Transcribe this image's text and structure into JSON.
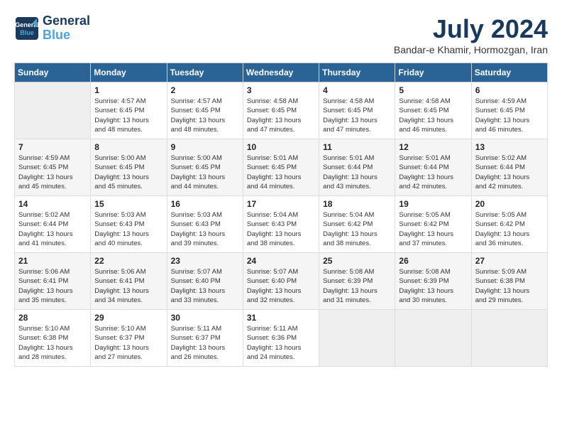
{
  "header": {
    "logo_line1": "General",
    "logo_line2": "Blue",
    "month": "July 2024",
    "location": "Bandar-e Khamir, Hormozgan, Iran"
  },
  "weekdays": [
    "Sunday",
    "Monday",
    "Tuesday",
    "Wednesday",
    "Thursday",
    "Friday",
    "Saturday"
  ],
  "weeks": [
    [
      {
        "day": "",
        "info": ""
      },
      {
        "day": "1",
        "info": "Sunrise: 4:57 AM\nSunset: 6:45 PM\nDaylight: 13 hours\nand 48 minutes."
      },
      {
        "day": "2",
        "info": "Sunrise: 4:57 AM\nSunset: 6:45 PM\nDaylight: 13 hours\nand 48 minutes."
      },
      {
        "day": "3",
        "info": "Sunrise: 4:58 AM\nSunset: 6:45 PM\nDaylight: 13 hours\nand 47 minutes."
      },
      {
        "day": "4",
        "info": "Sunrise: 4:58 AM\nSunset: 6:45 PM\nDaylight: 13 hours\nand 47 minutes."
      },
      {
        "day": "5",
        "info": "Sunrise: 4:58 AM\nSunset: 6:45 PM\nDaylight: 13 hours\nand 46 minutes."
      },
      {
        "day": "6",
        "info": "Sunrise: 4:59 AM\nSunset: 6:45 PM\nDaylight: 13 hours\nand 46 minutes."
      }
    ],
    [
      {
        "day": "7",
        "info": "Sunrise: 4:59 AM\nSunset: 6:45 PM\nDaylight: 13 hours\nand 45 minutes."
      },
      {
        "day": "8",
        "info": "Sunrise: 5:00 AM\nSunset: 6:45 PM\nDaylight: 13 hours\nand 45 minutes."
      },
      {
        "day": "9",
        "info": "Sunrise: 5:00 AM\nSunset: 6:45 PM\nDaylight: 13 hours\nand 44 minutes."
      },
      {
        "day": "10",
        "info": "Sunrise: 5:01 AM\nSunset: 6:45 PM\nDaylight: 13 hours\nand 44 minutes."
      },
      {
        "day": "11",
        "info": "Sunrise: 5:01 AM\nSunset: 6:44 PM\nDaylight: 13 hours\nand 43 minutes."
      },
      {
        "day": "12",
        "info": "Sunrise: 5:01 AM\nSunset: 6:44 PM\nDaylight: 13 hours\nand 42 minutes."
      },
      {
        "day": "13",
        "info": "Sunrise: 5:02 AM\nSunset: 6:44 PM\nDaylight: 13 hours\nand 42 minutes."
      }
    ],
    [
      {
        "day": "14",
        "info": "Sunrise: 5:02 AM\nSunset: 6:44 PM\nDaylight: 13 hours\nand 41 minutes."
      },
      {
        "day": "15",
        "info": "Sunrise: 5:03 AM\nSunset: 6:43 PM\nDaylight: 13 hours\nand 40 minutes."
      },
      {
        "day": "16",
        "info": "Sunrise: 5:03 AM\nSunset: 6:43 PM\nDaylight: 13 hours\nand 39 minutes."
      },
      {
        "day": "17",
        "info": "Sunrise: 5:04 AM\nSunset: 6:43 PM\nDaylight: 13 hours\nand 38 minutes."
      },
      {
        "day": "18",
        "info": "Sunrise: 5:04 AM\nSunset: 6:42 PM\nDaylight: 13 hours\nand 38 minutes."
      },
      {
        "day": "19",
        "info": "Sunrise: 5:05 AM\nSunset: 6:42 PM\nDaylight: 13 hours\nand 37 minutes."
      },
      {
        "day": "20",
        "info": "Sunrise: 5:05 AM\nSunset: 6:42 PM\nDaylight: 13 hours\nand 36 minutes."
      }
    ],
    [
      {
        "day": "21",
        "info": "Sunrise: 5:06 AM\nSunset: 6:41 PM\nDaylight: 13 hours\nand 35 minutes."
      },
      {
        "day": "22",
        "info": "Sunrise: 5:06 AM\nSunset: 6:41 PM\nDaylight: 13 hours\nand 34 minutes."
      },
      {
        "day": "23",
        "info": "Sunrise: 5:07 AM\nSunset: 6:40 PM\nDaylight: 13 hours\nand 33 minutes."
      },
      {
        "day": "24",
        "info": "Sunrise: 5:07 AM\nSunset: 6:40 PM\nDaylight: 13 hours\nand 32 minutes."
      },
      {
        "day": "25",
        "info": "Sunrise: 5:08 AM\nSunset: 6:39 PM\nDaylight: 13 hours\nand 31 minutes."
      },
      {
        "day": "26",
        "info": "Sunrise: 5:08 AM\nSunset: 6:39 PM\nDaylight: 13 hours\nand 30 minutes."
      },
      {
        "day": "27",
        "info": "Sunrise: 5:09 AM\nSunset: 6:38 PM\nDaylight: 13 hours\nand 29 minutes."
      }
    ],
    [
      {
        "day": "28",
        "info": "Sunrise: 5:10 AM\nSunset: 6:38 PM\nDaylight: 13 hours\nand 28 minutes."
      },
      {
        "day": "29",
        "info": "Sunrise: 5:10 AM\nSunset: 6:37 PM\nDaylight: 13 hours\nand 27 minutes."
      },
      {
        "day": "30",
        "info": "Sunrise: 5:11 AM\nSunset: 6:37 PM\nDaylight: 13 hours\nand 26 minutes."
      },
      {
        "day": "31",
        "info": "Sunrise: 5:11 AM\nSunset: 6:36 PM\nDaylight: 13 hours\nand 24 minutes."
      },
      {
        "day": "",
        "info": ""
      },
      {
        "day": "",
        "info": ""
      },
      {
        "day": "",
        "info": ""
      }
    ]
  ]
}
